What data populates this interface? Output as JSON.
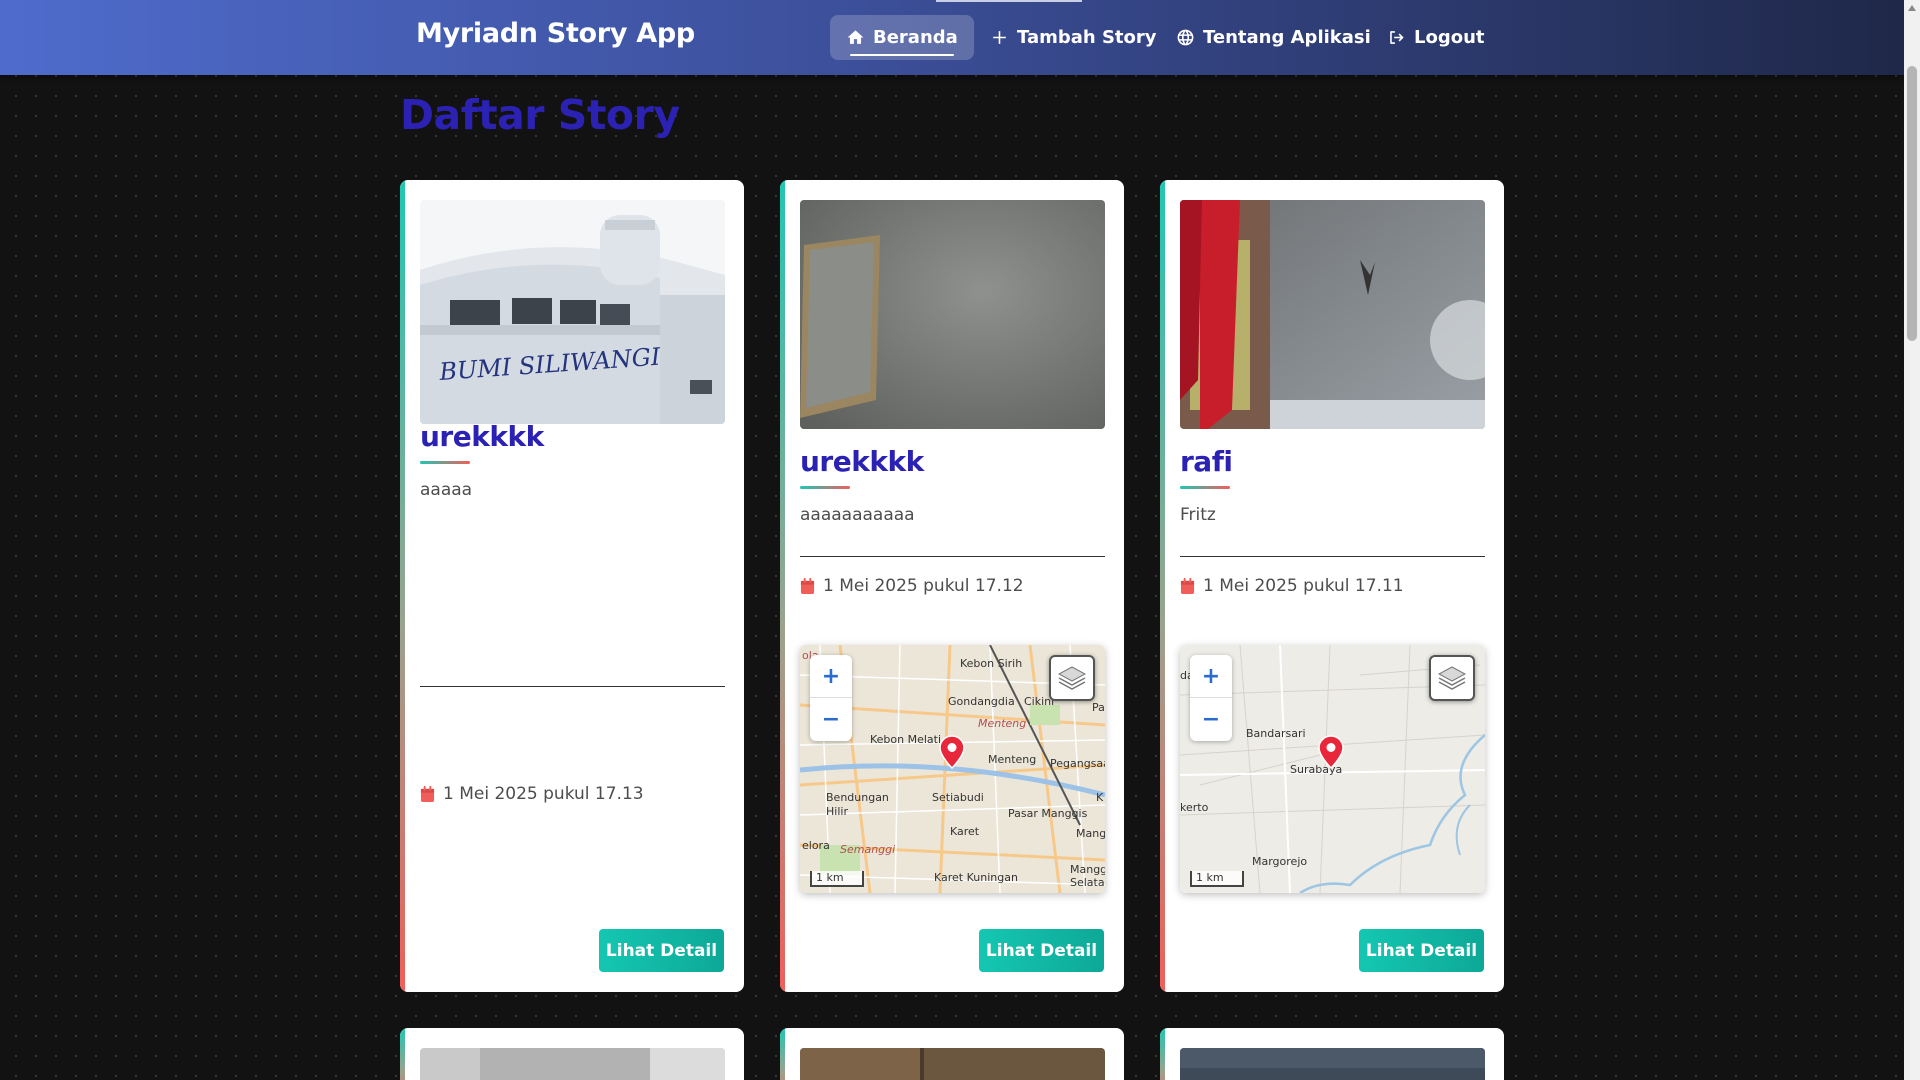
{
  "app": {
    "brand": "Myriadn Story App"
  },
  "nav": {
    "items": [
      {
        "label": "Beranda",
        "icon": "home-icon",
        "active": true
      },
      {
        "label": "Tambah Story",
        "icon": "plus-icon",
        "active": false
      },
      {
        "label": "Tentang Aplikasi",
        "icon": "globe-icon",
        "active": false
      },
      {
        "label": "Logout",
        "icon": "logout-icon",
        "active": false
      }
    ]
  },
  "page": {
    "title": "Daftar Story"
  },
  "colors": {
    "accent": "#2b22b4",
    "button": "#14c7b2",
    "date_icon": "#f05e5a",
    "navbar_start": "#4f6ccc",
    "navbar_end": "#1f2849"
  },
  "stories": [
    {
      "name": "urekkkk",
      "description": "aaaaa",
      "date": "1 Mei 2025 pukul 17.13",
      "image_text": "BUMI SILIWANGI",
      "has_map": false,
      "button": "Lihat Detail"
    },
    {
      "name": "urekkkk",
      "description": "aaaaaaaaaaa",
      "date": "1 Mei 2025 pukul 17.12",
      "has_map": true,
      "map": {
        "zoom_in": "+",
        "zoom_out": "−",
        "scale": "1 km",
        "labels": [
          "Kebon Sirih",
          "Gondangdia",
          "Cikini",
          "Menteng",
          "Kebon Melati",
          "Menteng",
          "Pegangsaan",
          "Bendungan Hilir",
          "Setiabudi",
          "Pasar Manggis",
          "Karet",
          "Semanggi",
          "Karet Kuningan",
          "Mangga Selatan",
          "Pa",
          "ola",
          "K",
          "Mang",
          "elora"
        ]
      },
      "button": "Lihat Detail"
    },
    {
      "name": "rafi",
      "description": "Fritz",
      "date": "1 Mei 2025 pukul 17.11",
      "has_map": true,
      "map": {
        "zoom_in": "+",
        "zoom_out": "−",
        "scale": "1 km",
        "labels": [
          "Bandarsari",
          "Surabaya",
          "Margorejo",
          "kerto",
          "da"
        ]
      },
      "button": "Lihat Detail"
    }
  ]
}
